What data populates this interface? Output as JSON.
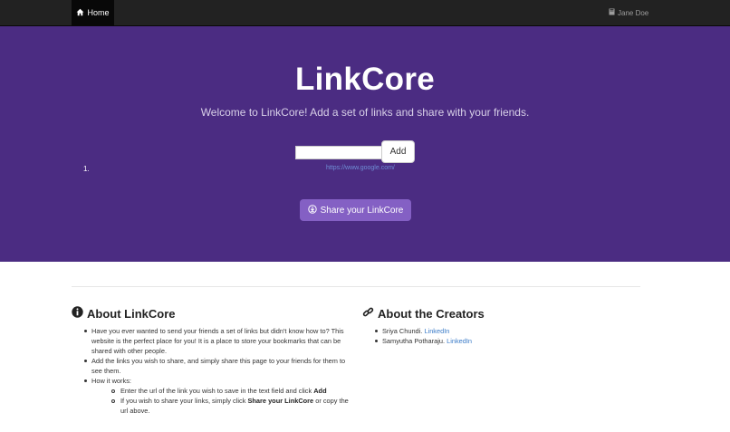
{
  "navbar": {
    "home_label": "Home",
    "user_label": "Jane Doe"
  },
  "hero": {
    "title": "LinkCore",
    "welcome": "Welcome to LinkCore! Add a set of links and share with your friends.",
    "input_value": "",
    "add_label": "Add",
    "links": [
      {
        "number": "1.",
        "url": "https://www.google.com/"
      }
    ],
    "share_label": "Share your LinkCore"
  },
  "about": {
    "heading": "About LinkCore",
    "intro": "Have you ever wanted to send your friends a set of links but didn't know how to? This website is the perfect place for you! It is a place to store your bookmarks that can be shared with other people.",
    "add_links": "Add the links you wish to share, and simply share this page to your friends for them to see them.",
    "how_it_works": "How it works:",
    "step1_pre": "Enter the url of the link you wish to save in the text field and click ",
    "step1_bold": "Add",
    "step2_pre": "If you wish to share your links, simply click ",
    "step2_bold": "Share your LinkCore",
    "step2_post": " or copy the url above."
  },
  "creators": {
    "heading": "About the Creators",
    "items": [
      {
        "name": "Sriya Chundi.",
        "link": "LinkedIn"
      },
      {
        "name": "Samyutha Potharaju.",
        "link": "LinkedIn"
      }
    ]
  },
  "colors": {
    "navbar": "#222222",
    "hero": "#4b2c82",
    "share_button": "#8460c4",
    "link": "#3a7bc8"
  },
  "icons": {
    "home": "home-icon",
    "user": "book-icon",
    "share": "download-circle-icon",
    "about": "info-circle-icon",
    "creators": "link-icon"
  }
}
